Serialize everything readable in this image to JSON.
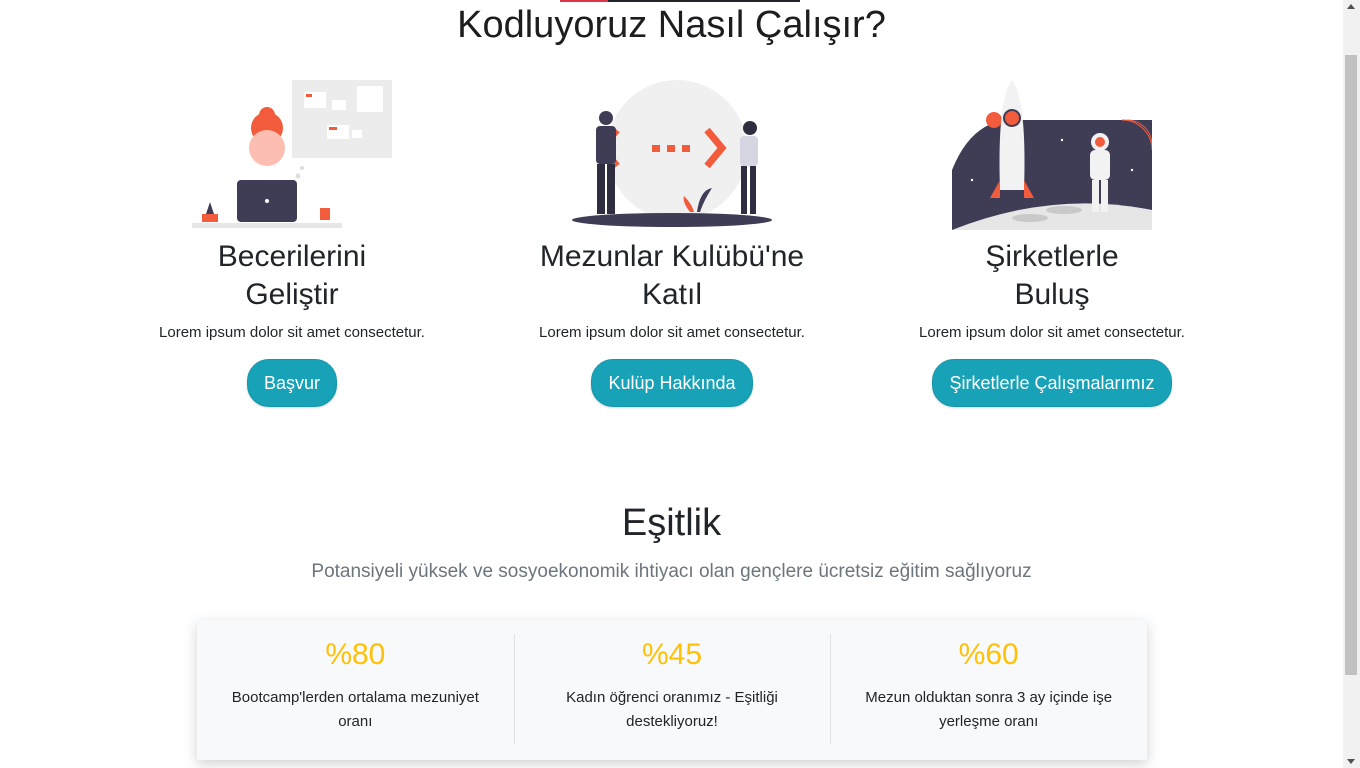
{
  "how_it_works": {
    "title": "Kodluyoruz Nasıl Çalışır?",
    "features": [
      {
        "title_line1": "Becerilerini",
        "title_line2": "Geliştir",
        "text": "Lorem ipsum dolor sit amet consectetur.",
        "button": "Başvur",
        "icon": "developer-illustration"
      },
      {
        "title_line1": "Mezunlar Kulübü'ne",
        "title_line2": "Katıl",
        "text": "Lorem ipsum dolor sit amet consectetur.",
        "button": "Kulüp Hakkında",
        "icon": "collaboration-illustration"
      },
      {
        "title_line1": "Şirketlerle",
        "title_line2": "Buluş",
        "text": "Lorem ipsum dolor sit amet consectetur.",
        "button": "Şirketlerle Çalışmalarımız",
        "icon": "rocket-astronaut-illustration"
      }
    ]
  },
  "equality": {
    "title": "Eşitlik",
    "lead": "Potansiyeli yüksek ve sosyoekonomik ihtiyacı olan gençlere ücretsiz eğitim sağlıyoruz",
    "stats": [
      {
        "value": "%80",
        "label": "Bootcamp'lerden ortalama mezuniyet oranı"
      },
      {
        "value": "%45",
        "label": "Kadın öğrenci oranımız - Eşitliği destekliyoruz!"
      },
      {
        "value": "%60",
        "label": "Mezun olduktan sonra 3 ay içinde işe yerleşme oranı"
      }
    ]
  },
  "colors": {
    "button": "#17a2b8",
    "stat_number": "#ffc107",
    "accent": "#f25c3c",
    "dark": "#3f3d56"
  }
}
